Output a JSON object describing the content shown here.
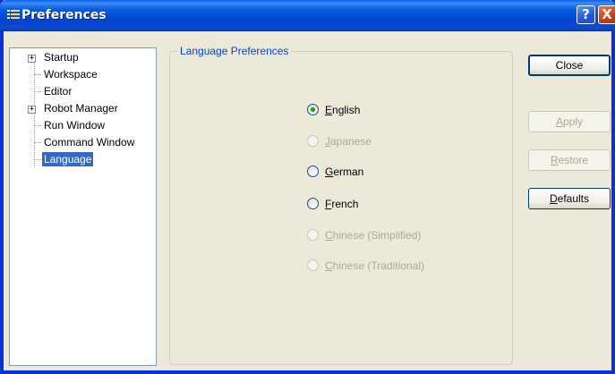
{
  "window": {
    "title": "Preferences",
    "help_label": "?",
    "close_label": "X"
  },
  "tree": {
    "items": [
      {
        "label": "Startup",
        "expander": "+"
      },
      {
        "label": "Workspace"
      },
      {
        "label": "Editor"
      },
      {
        "label": "Robot Manager",
        "expander": "+"
      },
      {
        "label": "Run Window"
      },
      {
        "label": "Command Window"
      },
      {
        "label": "Language",
        "selected": true
      }
    ]
  },
  "group": {
    "title": "Language Preferences",
    "options": [
      {
        "label": "English",
        "checked": true,
        "enabled": true
      },
      {
        "label": "Japanese",
        "checked": false,
        "enabled": false
      },
      {
        "label": "German",
        "checked": false,
        "enabled": true
      },
      {
        "label": "French",
        "checked": false,
        "enabled": true
      },
      {
        "label": "Chinese (Simplified)",
        "checked": false,
        "enabled": false
      },
      {
        "label": "Chinese (Traditional)",
        "checked": false,
        "enabled": false
      }
    ]
  },
  "buttons": {
    "close": "Close",
    "apply": "Apply",
    "restore": "Restore",
    "defaults": "Defaults"
  },
  "colors": {
    "titlebar": "#0a49cf",
    "selection": "#316ac5",
    "group_title": "#0046d5",
    "check_dot": "#21a121"
  }
}
